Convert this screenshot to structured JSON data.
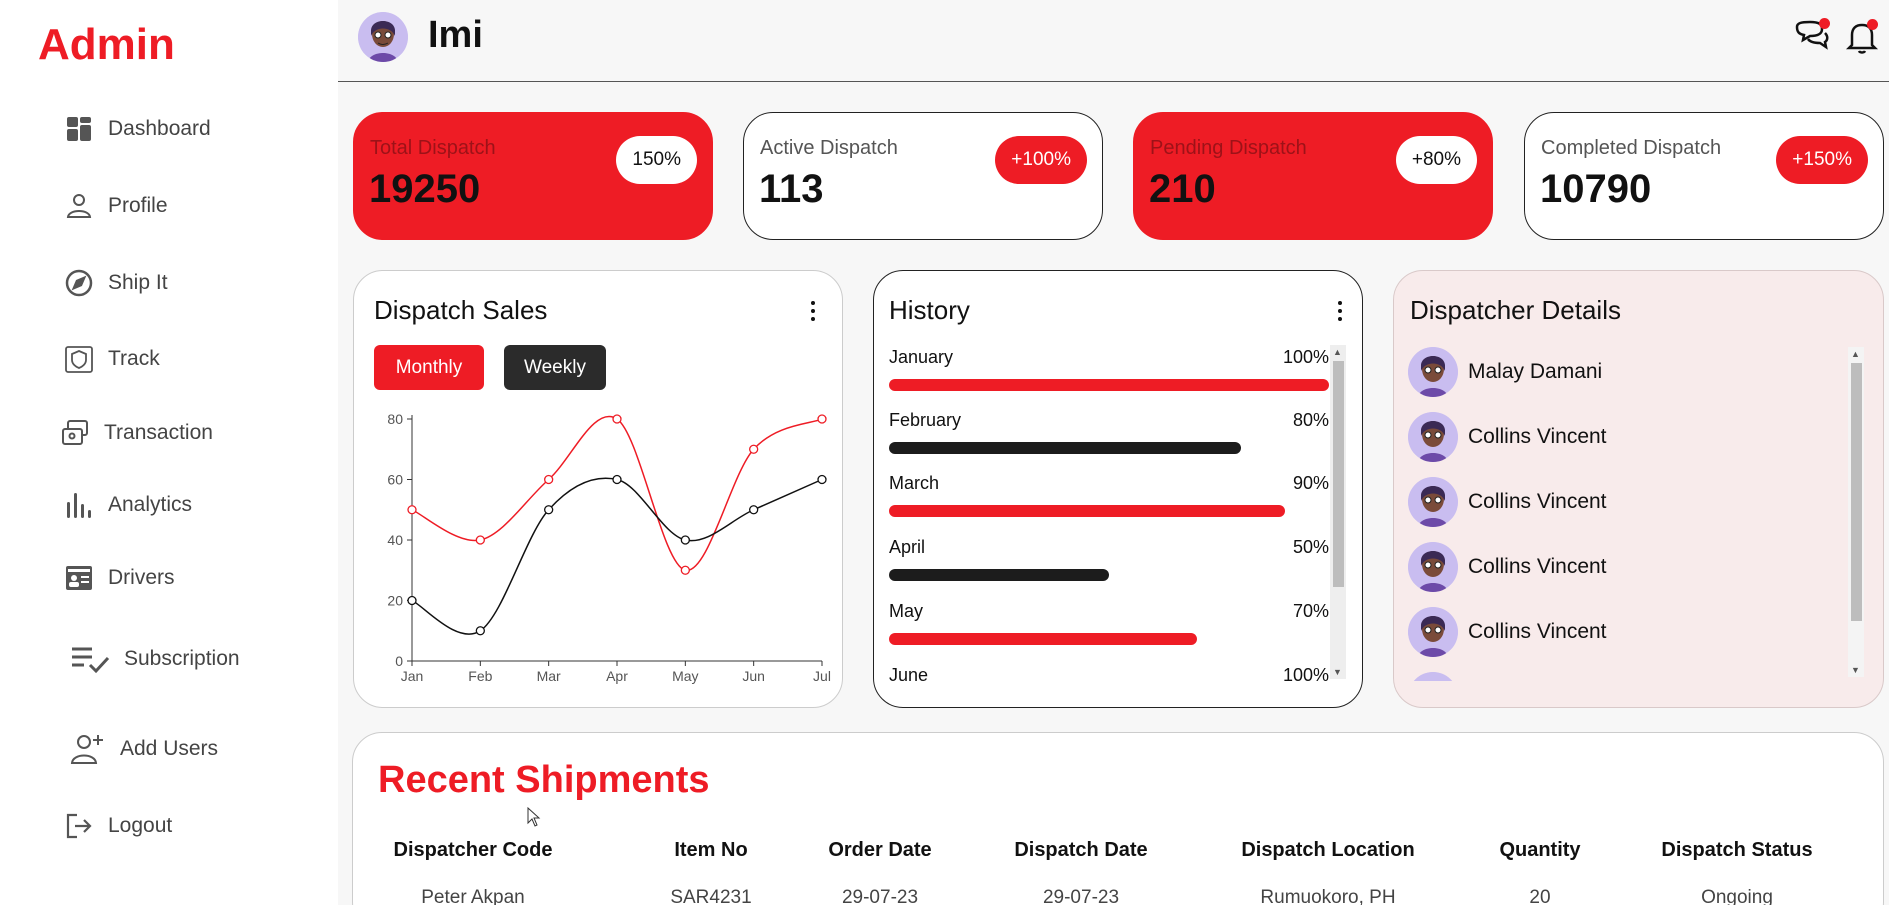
{
  "sidebar": {
    "brand": "Admin",
    "items": [
      {
        "label": "Dashboard",
        "icon": "dashboard-icon"
      },
      {
        "label": "Profile",
        "icon": "user-icon"
      },
      {
        "label": "Ship It",
        "icon": "compass-icon"
      },
      {
        "label": "Track",
        "icon": "shield-map-icon"
      },
      {
        "label": "Transaction",
        "icon": "transaction-icon"
      },
      {
        "label": "Analytics",
        "icon": "bar-chart-icon"
      },
      {
        "label": "Drivers",
        "icon": "id-card-icon"
      },
      {
        "label": "Subscription",
        "icon": "checklist-icon"
      },
      {
        "label": "Add Users",
        "icon": "add-user-icon"
      },
      {
        "label": "Logout",
        "icon": "logout-icon"
      }
    ]
  },
  "header": {
    "user_name": "Imi",
    "icons": [
      "chat-icon",
      "bell-icon"
    ]
  },
  "stats": [
    {
      "label": "Total Dispatch",
      "value": "19250",
      "badge": "150%",
      "accent": "red"
    },
    {
      "label": "Active Dispatch",
      "value": "113",
      "badge": "+100%",
      "accent": "white"
    },
    {
      "label": "Pending Dispatch",
      "value": "210",
      "badge": "+80%",
      "accent": "red"
    },
    {
      "label": "Completed Dispatch",
      "value": "10790",
      "badge": "+150%",
      "accent": "white"
    }
  ],
  "sales": {
    "title": "Dispatch Sales",
    "monthly_label": "Monthly",
    "weekly_label": "Weekly"
  },
  "chart_data": {
    "type": "line",
    "title": "",
    "xlabel": "",
    "ylabel": "",
    "categories": [
      "Jan",
      "Feb",
      "Mar",
      "Apr",
      "May",
      "Jun",
      "Jul"
    ],
    "ylim": [
      0,
      80
    ],
    "yticks": [
      0,
      20,
      40,
      60,
      80
    ],
    "series": [
      {
        "values": [
          50,
          40,
          60,
          80,
          30,
          70,
          80
        ],
        "color": "#ee1c25"
      },
      {
        "values": [
          20,
          10,
          50,
          60,
          40,
          50,
          60
        ],
        "color": "#111111"
      }
    ],
    "grid": false,
    "smooth": true
  },
  "history": {
    "title": "History",
    "rows": [
      {
        "label": "January",
        "pct": "100%",
        "value": 100,
        "color": "#ee1c25"
      },
      {
        "label": "February",
        "pct": "80%",
        "value": 80,
        "color": "#1c1c1c"
      },
      {
        "label": "March",
        "pct": "90%",
        "value": 90,
        "color": "#ee1c25"
      },
      {
        "label": "April",
        "pct": "50%",
        "value": 50,
        "color": "#1c1c1c"
      },
      {
        "label": "May",
        "pct": "70%",
        "value": 70,
        "color": "#ee1c25"
      },
      {
        "label": "June",
        "pct": "100%",
        "value": 100,
        "color": "#1c1c1c"
      }
    ]
  },
  "dispatchers": {
    "title": "Dispatcher Details",
    "items": [
      "Malay Damani",
      "Collins Vincent",
      "Collins Vincent",
      "Collins Vincent",
      "Collins Vincent"
    ]
  },
  "shipments": {
    "title": "Recent Shipments",
    "columns": [
      "Dispatcher Code",
      "Item No",
      "Order Date",
      "Dispatch Date",
      "Dispatch Location",
      "Quantity",
      "Dispatch Status"
    ],
    "rows": [
      [
        "Peter Akpan",
        "SAR4231",
        "29-07-23",
        "29-07-23",
        "Rumuokoro, PH",
        "20",
        "Ongoing"
      ]
    ]
  },
  "colors": {
    "accent": "#ee1c25",
    "dark": "#2b2b2b",
    "dispatcher_bg": "#f8ebeb"
  }
}
